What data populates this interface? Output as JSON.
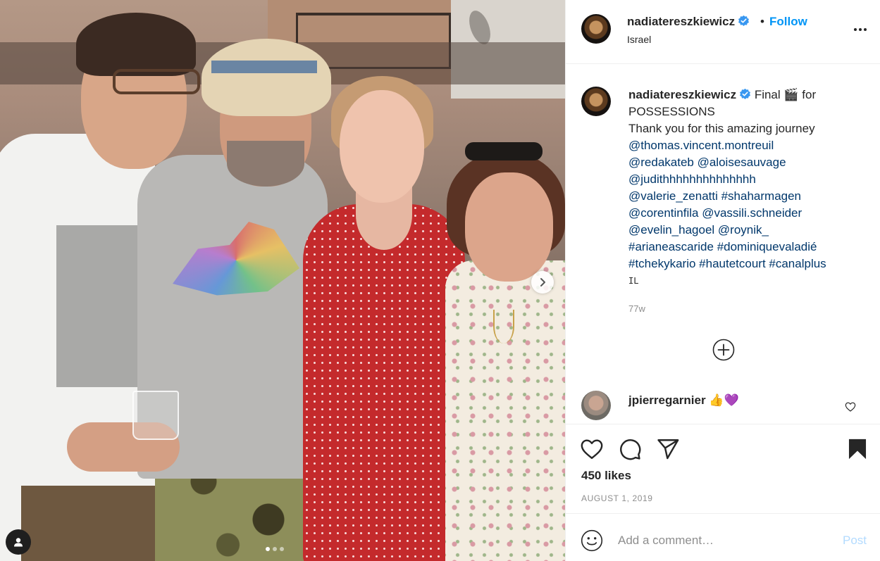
{
  "post": {
    "image_alt": "Four people posing outdoors",
    "carousel_dots": 3,
    "carousel_active": 1
  },
  "header": {
    "username": "nadiatereszkiewicz",
    "separator": "•",
    "follow_label": "Follow",
    "location": "Israel",
    "verified": true
  },
  "caption": {
    "username": "nadiatereszkiewicz",
    "text_after_name": "Final 🎬 for",
    "lines": [
      "POSSESSIONS",
      "Thank you for this amazing journey"
    ],
    "mention_lines": [
      "@thomas.vincent.montreuil",
      "@redakateb @aloisesauvage",
      "@judithhhhhhhhhhhhhh",
      "@valerie_zenatti #shaharmagen",
      "@corentinfila @vassili.schneider",
      "@evelin_hagoel @roynik_",
      "#arianeascaride #dominiquevaladié",
      "#tchekykario #hautetcourt #canalplus"
    ],
    "flag_text": "IL",
    "time_ago": "77w"
  },
  "comment": {
    "username": "jpierregarnier",
    "text": "👍💜"
  },
  "engagement": {
    "likes_text": "450 likes",
    "date_text": "AUGUST 1, 2019"
  },
  "composer": {
    "placeholder": "Add a comment…",
    "post_label": "Post"
  },
  "colors": {
    "accent": "#0095f6",
    "link": "#00376b",
    "muted": "#8e8e8e",
    "post_disabled": "#b3dbff"
  }
}
